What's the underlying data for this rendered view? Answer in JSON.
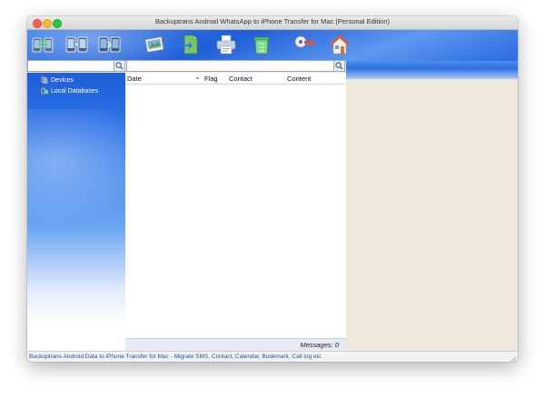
{
  "window": {
    "title": "Backuptrans Android WhatsApp to iPhone Transfer for Mac (Personal Edition)"
  },
  "toolbar": {
    "buttons": [
      {
        "icon": "transfer-phones-icon"
      },
      {
        "icon": "backup-phones-icon"
      },
      {
        "icon": "restore-phones-icon"
      },
      {
        "icon": "photo-icon"
      },
      {
        "icon": "export-document-icon"
      },
      {
        "icon": "print-icon"
      },
      {
        "icon": "trash-icon"
      },
      {
        "icon": "key-register-icon"
      },
      {
        "icon": "home-icon"
      }
    ]
  },
  "sidebar": {
    "items": [
      {
        "label": "Devices",
        "icon": "device-icon"
      },
      {
        "label": "Local Databases",
        "icon": "database-icon"
      }
    ]
  },
  "list": {
    "columns": {
      "date": "Date",
      "flag": "Flag",
      "contact": "Contact",
      "content": "Content"
    },
    "rows": [],
    "messages_label": "Messages: 0"
  },
  "status": {
    "text": "Backuptrans Android Data to iPhone Transfer for Mac - Migrate SMS, Contact, Calendar, Bookmark, Call log etc"
  },
  "colors": {
    "toolbar_blue": "#2a6ae0",
    "pane_beige": "#eee7dc",
    "status_text": "#1d4fa8"
  }
}
